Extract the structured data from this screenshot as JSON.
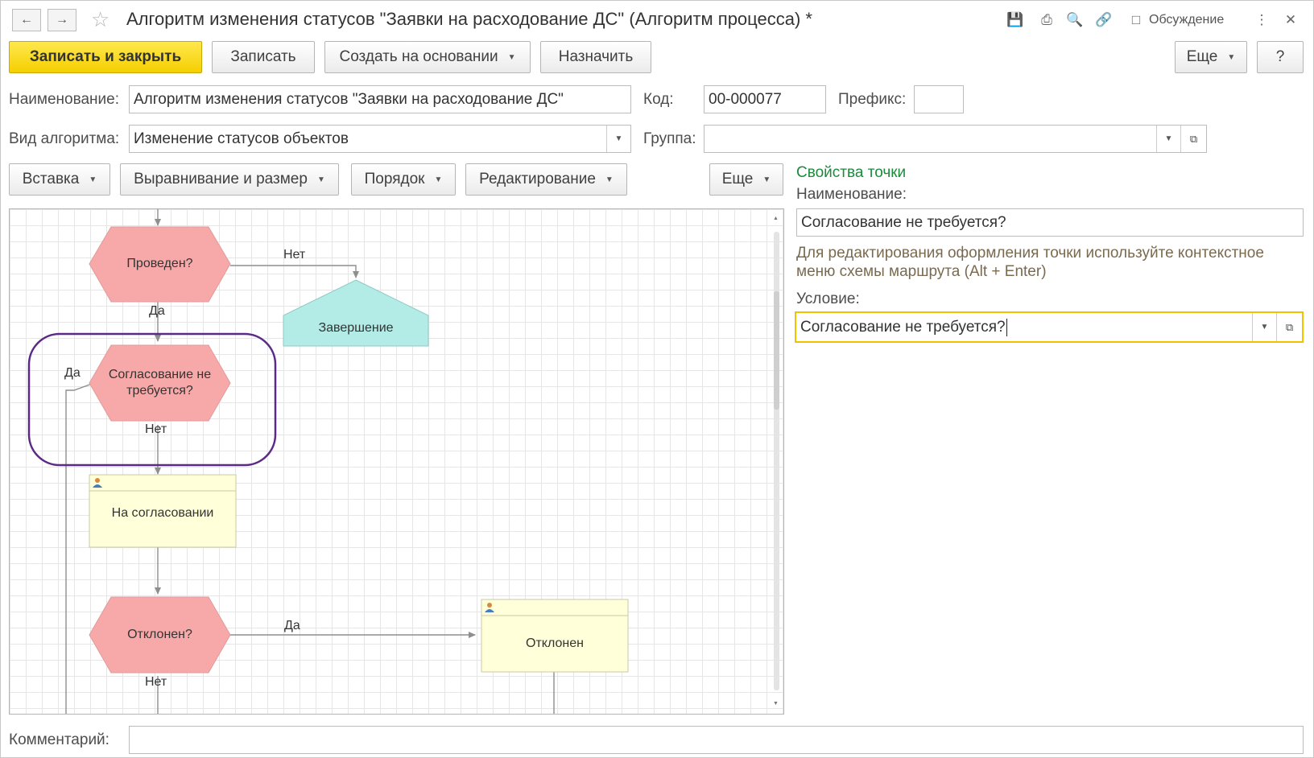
{
  "window": {
    "title": "Алгоритм изменения статусов \"Заявки на расходование ДС\" (Алгоритм процесса) *",
    "discussion": "Обсуждение"
  },
  "toolbar": {
    "save_close": "Записать и закрыть",
    "save": "Записать",
    "create_based": "Создать на основании",
    "assign": "Назначить",
    "more": "Еще",
    "help": "?"
  },
  "form": {
    "name_label": "Наименование:",
    "name_value": "Алгоритм изменения статусов \"Заявки на расходование ДС\"",
    "code_label": "Код:",
    "code_value": "00-000077",
    "prefix_label": "Префикс:",
    "prefix_value": "",
    "type_label": "Вид алгоритма:",
    "type_value": "Изменение статусов объектов",
    "group_label": "Группа:",
    "group_value": "",
    "comment_label": "Комментарий:",
    "comment_value": ""
  },
  "scheme_toolbar": {
    "insert": "Вставка",
    "align": "Выравнивание и размер",
    "order": "Порядок",
    "edit": "Редактирование",
    "more": "Еще"
  },
  "diagram": {
    "nodes": {
      "posted": "Проведен?",
      "finish": "Завершение",
      "approval_line1": "Согласование не",
      "approval_line2": "требуется?",
      "on_approval": "На согласовании",
      "rejected_q": "Отклонен?",
      "rejected": "Отклонен"
    },
    "edges": {
      "no1": "Нет",
      "yes1": "Да",
      "yes2": "Да",
      "no2": "Нет",
      "yes3": "Да",
      "no3": "Нет"
    }
  },
  "props": {
    "header": "Свойства точки",
    "name_label": "Наименование:",
    "name_value": "Согласование не требуется?",
    "hint": "Для редактирования оформления точки используйте контекстное меню схемы маршрута (Alt + Enter)",
    "condition_label": "Условие:",
    "condition_value": "Согласование не требуется?"
  },
  "colors": {
    "accent": "#f5cf00",
    "hexagon_fill": "#f7a9a9",
    "end_fill": "#b3ebe6",
    "task_fill": "#ffffd9",
    "highlight": "#5b2a86",
    "props_header": "#1d8a3c",
    "focus": "#f2c200"
  }
}
